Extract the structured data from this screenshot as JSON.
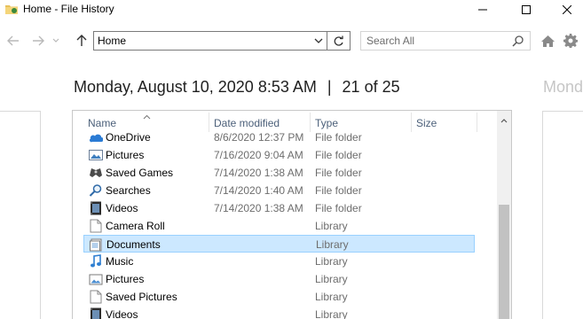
{
  "window": {
    "title": "Home - File History"
  },
  "nav": {
    "address_value": "Home",
    "search_placeholder": "Search All"
  },
  "heading": {
    "date": "Monday, August 10, 2020 8:53 AM",
    "separator": "|",
    "position": "21 of 25",
    "next_ghost": "Mond"
  },
  "columns": {
    "name": "Name",
    "date_modified": "Date modified",
    "type": "Type",
    "size": "Size"
  },
  "rows": [
    {
      "name": "OneDrive",
      "date": "8/6/2020 12:37 PM",
      "type": "File folder",
      "icon": "onedrive-icon",
      "selected": false
    },
    {
      "name": "Pictures",
      "date": "7/16/2020 9:04 AM",
      "type": "File folder",
      "icon": "pictures-icon",
      "selected": false
    },
    {
      "name": "Saved Games",
      "date": "7/14/2020 1:38 AM",
      "type": "File folder",
      "icon": "saved-games-icon",
      "selected": false
    },
    {
      "name": "Searches",
      "date": "7/14/2020 1:40 AM",
      "type": "File folder",
      "icon": "searches-icon",
      "selected": false
    },
    {
      "name": "Videos",
      "date": "7/14/2020 1:38 AM",
      "type": "File folder",
      "icon": "videos-icon",
      "selected": false
    },
    {
      "name": "Camera Roll",
      "date": "",
      "type": "Library",
      "icon": "library-icon",
      "selected": false
    },
    {
      "name": "Documents",
      "date": "",
      "type": "Library",
      "icon": "documents-library-icon",
      "selected": true
    },
    {
      "name": "Music",
      "date": "",
      "type": "Library",
      "icon": "music-icon",
      "selected": false
    },
    {
      "name": "Pictures",
      "date": "",
      "type": "Library",
      "icon": "pictures-library-icon",
      "selected": false
    },
    {
      "name": "Saved Pictures",
      "date": "",
      "type": "Library",
      "icon": "library-icon",
      "selected": false
    },
    {
      "name": "Videos",
      "date": "",
      "type": "Library",
      "icon": "videos-icon",
      "selected": false
    }
  ],
  "colors": {
    "selection_bg": "#cce8ff",
    "selection_border": "#99d1ff",
    "header_text": "#4c607a",
    "secondary_text": "#6d6d6d"
  }
}
